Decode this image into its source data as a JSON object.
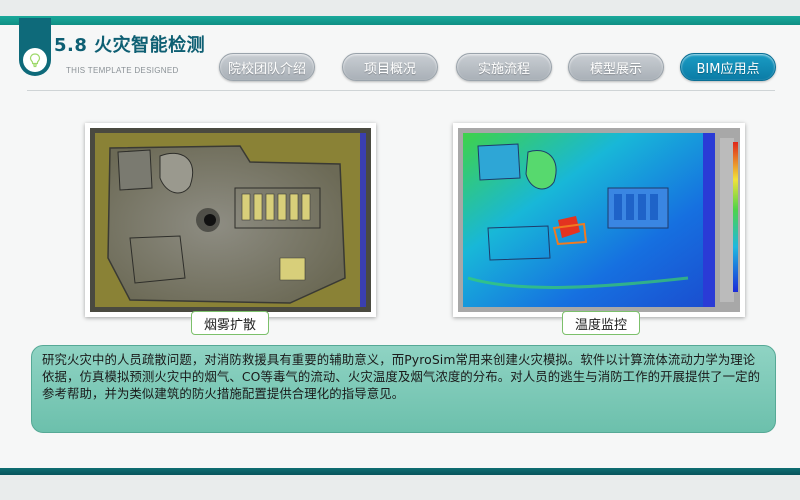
{
  "header": {
    "title": "5.8 火灾智能检测",
    "subtitle": "THIS TEMPLATE DESIGNED"
  },
  "nav": {
    "items": [
      {
        "label": "院校团队介绍",
        "active": false
      },
      {
        "label": "项目概况",
        "active": false
      },
      {
        "label": "实施流程",
        "active": false
      },
      {
        "label": "模型展示",
        "active": false
      },
      {
        "label": "BIM应用点",
        "active": true
      }
    ]
  },
  "figures": {
    "left_caption": "烟雾扩散",
    "right_caption": "温度监控"
  },
  "description": "研究火灾中的人员疏散问题，对消防救援具有重要的辅助意义，而PyroSim常用来创建火灾模拟。软件以计算流体流动力学为理论依据，仿真模拟预测火灾中的烟气、CO等毒气的流动、火灾温度及烟气浓度的分布。对人员的逃生与消防工作的开展提供了一定的参考帮助，并为类似建筑的防火措施配置提供合理化的指导意见。",
  "colors": {
    "accent": "#1aa99b",
    "title": "#0e5f73",
    "active_tab": "#0b7ca6"
  },
  "icons": {
    "header": "lightbulb-icon"
  }
}
